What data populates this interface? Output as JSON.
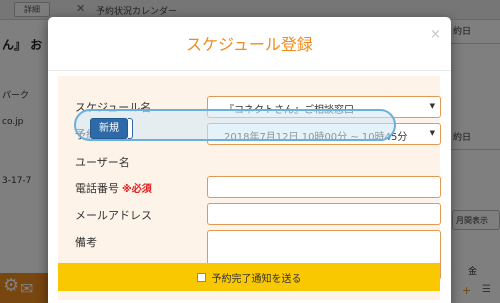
{
  "background": {
    "detail_button": "詳細",
    "close_icon": "✕",
    "calendar_title": "予約状況カレンダー",
    "shop_name": "ん』 お",
    "park_text": "パーク",
    "email_domain": "co.jp",
    "address": "3-17-7",
    "col_header_1": "約日",
    "col_header_2": "約日",
    "monthly_select": "月間表示",
    "kin": "金",
    "plus_icon": "+"
  },
  "modal": {
    "title": "スケジュール登録",
    "close": "×",
    "fields": {
      "schedule_name_label": "スケジュール名",
      "schedule_name_value": "『コネクトさん』ご相談窓口",
      "datetime_label": "予約日時",
      "datetime_value": "2018年7月12日 10時00分 ~ 10時45分",
      "user_label": "ユーザー名",
      "new_button": "新規",
      "user_value": "",
      "phone_label": "電話番号",
      "required": "※必須",
      "phone_value": "",
      "email_label": "メールアドレス",
      "email_value": "",
      "notes_label": "備考",
      "notes_value": ""
    },
    "notify_label": "予約完了通知を送る"
  }
}
